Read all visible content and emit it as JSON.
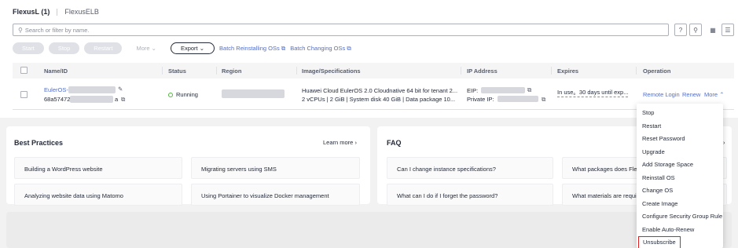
{
  "tabs": [
    {
      "label": "FlexusL (1)"
    },
    {
      "label": "FlexusELB"
    }
  ],
  "search": {
    "placeholder": "Search or filter by name."
  },
  "toolbar": {
    "start": "Start",
    "stop": "Stop",
    "restart": "Restart",
    "more": "More",
    "export": "Export",
    "batch_reinstall": "Batch Reinstalling OSs",
    "batch_change": "Batch Changing OSs"
  },
  "table": {
    "headers": [
      "Name/ID",
      "Status",
      "Region",
      "Image/Specifications",
      "IP Address",
      "Expires",
      "Operation"
    ],
    "row": {
      "name": "EulerOS-",
      "id_prefix": "68a57472",
      "id_suffix": "a",
      "status": "Running",
      "image_line1": "Huawei Cloud EulerOS 2.0 Cloudnative 64 bit for tenant 2...",
      "image_line2": "2 vCPUs | 2 GiB | System disk 40 GiB | Data package 10...",
      "eip_label": "EIP:",
      "private_ip_label": "Private IP:",
      "expires": "In use。30 days until exp...",
      "op_remote": "Remote Login",
      "op_renew": "Renew",
      "op_more": "More"
    }
  },
  "best_practices": {
    "title": "Best Practices",
    "learn_more": "Learn more",
    "items": [
      "Building a WordPress website",
      "Migrating servers using SMS",
      "Analyzing website data using Matomo",
      "Using Portainer to visualize Docker management"
    ]
  },
  "faq": {
    "title": "FAQ",
    "items": [
      "Can I change instance specifications?",
      "What packages does Fle",
      "What can I do if I forget the password?",
      "What materials are requi"
    ]
  },
  "more_menu": [
    "Stop",
    "Restart",
    "Reset Password",
    "Upgrade",
    "Add Storage Space",
    "Reinstall OS",
    "Change OS",
    "Create Image",
    "Configure Security Group Rule",
    "Enable Auto-Renew",
    "Unsubscribe"
  ],
  "colors": {
    "link": "#526ecc",
    "running": "#50b83c",
    "highlight_border": "#e02020"
  }
}
